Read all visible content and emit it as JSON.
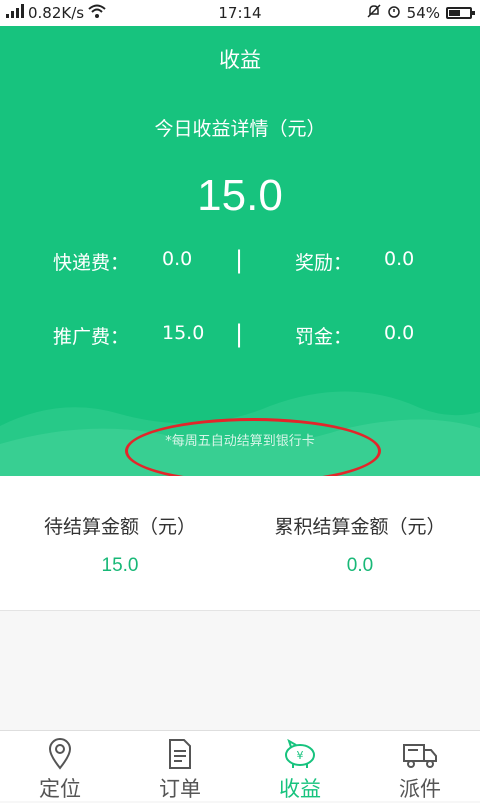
{
  "status_bar": {
    "network": "4G",
    "speed": "0.82K/s",
    "time": "17:14",
    "battery": "54%",
    "battery_level": 0.54
  },
  "header": {
    "title": "收益",
    "subtitle": "今日收益详情（元）",
    "total": "15.0",
    "rows": [
      {
        "label1": "快递费：",
        "value1": "0.0",
        "divider": "|",
        "label2": "奖励：",
        "value2": "0.0"
      },
      {
        "label1": "推广费：",
        "value1": "15.0",
        "divider": "|",
        "label2": "罚金：",
        "value2": "0.0"
      }
    ],
    "note": "*每周五自动结算到银行卡"
  },
  "settlement": {
    "pending_label": "待结算金额（元）",
    "pending_value": "15.0",
    "total_label": "累积结算金额（元）",
    "total_value": "0.0"
  },
  "nav": {
    "tabs": [
      {
        "label": "定位",
        "icon": "location-pin-icon"
      },
      {
        "label": "订单",
        "icon": "order-document-icon"
      },
      {
        "label": "收益",
        "icon": "piggy-bank-icon",
        "active": true
      },
      {
        "label": "派件",
        "icon": "delivery-truck-icon"
      }
    ]
  },
  "colors": {
    "primary": "#17c37e",
    "annotation": "#e3262a"
  }
}
